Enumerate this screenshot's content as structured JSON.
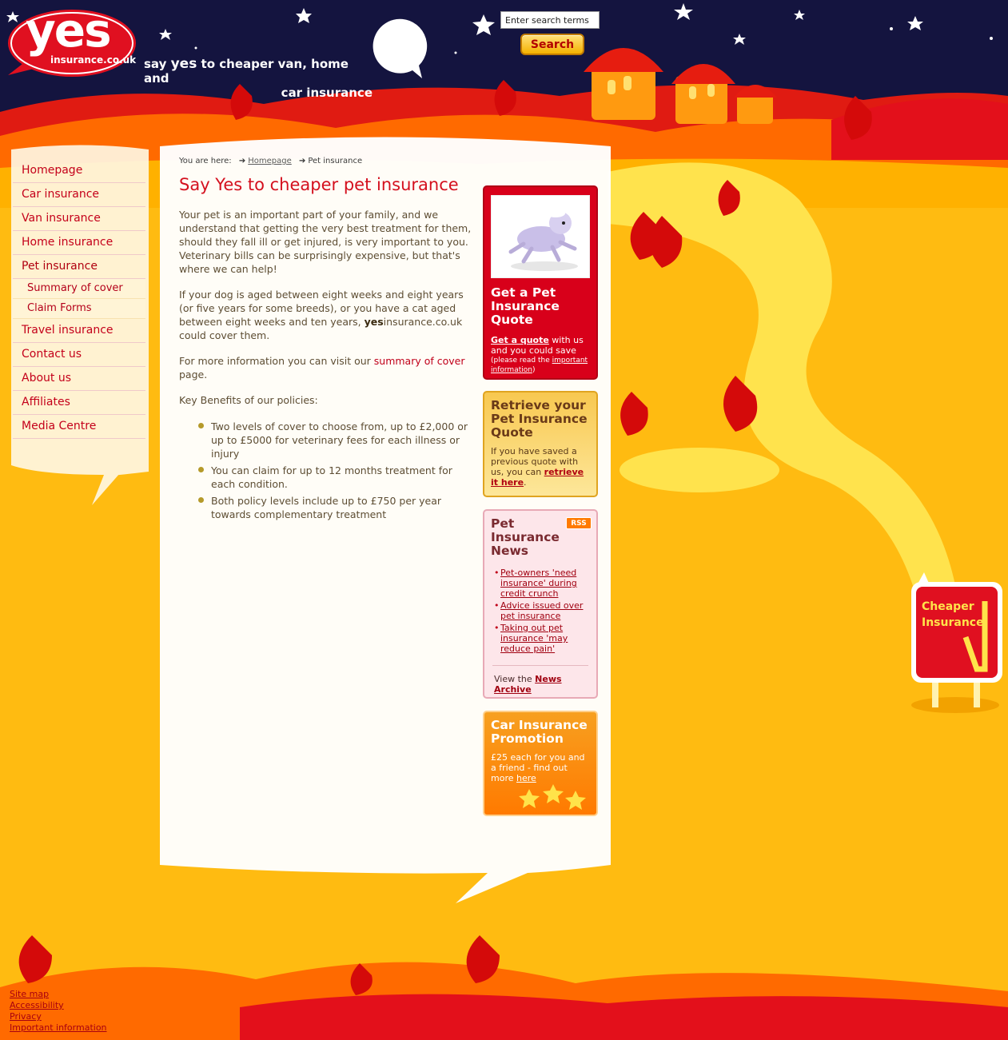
{
  "logo": {
    "word": "yes",
    "domain": "insurance.co.uk"
  },
  "tagline": {
    "line1_pre": "say ",
    "line1_bold": "yes",
    "line1_post": " to cheaper van, home and",
    "line2": "car insurance"
  },
  "search": {
    "placeholder": "Enter search terms",
    "button_label": "Search"
  },
  "nav": {
    "items": [
      {
        "label": "Homepage"
      },
      {
        "label": "Car insurance"
      },
      {
        "label": "Van insurance"
      },
      {
        "label": "Home insurance"
      },
      {
        "label": "Pet insurance"
      },
      {
        "label": "Summary of cover"
      },
      {
        "label": "Claim Forms"
      },
      {
        "label": "Travel insurance"
      },
      {
        "label": "Contact us"
      },
      {
        "label": "About us"
      },
      {
        "label": "Affiliates"
      },
      {
        "label": "Media Centre"
      }
    ]
  },
  "breadcrumb": {
    "prefix": "You are here:",
    "home": "Homepage",
    "current": "Pet insurance"
  },
  "main": {
    "title": "Say Yes to cheaper pet insurance",
    "para1": "Your pet is an important part of your family, and we understand that getting the very best treatment for them, should they fall ill or get injured, is very important to you. Veterinary bills can be surprisingly expensive, but that's where we can help!",
    "para2_pre": "If your dog is aged between eight weeks and eight years (or five years for some breeds), or you have a cat aged between eight weeks and ten years, ",
    "para2_bold": "yes",
    "para2_post": "insurance.co.uk could cover them.",
    "para3_pre": "For more information you can visit our ",
    "para3_link": "summary of cover",
    "para3_post": " page.",
    "benefits_heading": "Key Benefits of our policies:",
    "benefits": [
      "Two levels of cover to choose from, up to £2,000 or up to £5000 for veterinary fees for each illness or injury",
      "You can claim for up to 12 months treatment for each condition.",
      "Both policy levels include up to £750 per year towards complementary treatment"
    ]
  },
  "quote_box": {
    "title": "Get a Pet Insurance Quote",
    "link": "Get a quote",
    "text": " with us and you could save",
    "note_pre": "(please read the ",
    "note_link": "important information",
    "note_post": ")"
  },
  "retrieve_box": {
    "title": "Retrieve your Pet Insurance Quote",
    "text": "If you have saved a previous quote with us, you can ",
    "link": "retrieve it here",
    "post": "."
  },
  "news_box": {
    "title": "Pet Insurance News",
    "rss": "RSS",
    "items": [
      "Pet-owners 'need insurance' during credit crunch",
      "Advice issued over pet insurance",
      "Taking out pet insurance 'may reduce pain'"
    ],
    "archive_pre": "View the ",
    "archive_link": "News Archive"
  },
  "promo_box": {
    "title": "Car Insurance Promotion",
    "text": "£25 each for you and a friend - find out more ",
    "link": "here"
  },
  "signpost": {
    "line1": "Cheaper",
    "line2": "Insurance"
  },
  "footer": {
    "links": [
      "Site map",
      "Accessibility",
      "Privacy",
      "Important information"
    ]
  },
  "colors": {
    "night_sky": "#13133f",
    "brand_red": "#d8001a",
    "field_yellow": "#ffbb11",
    "hill_orange": "#ff8c00"
  }
}
